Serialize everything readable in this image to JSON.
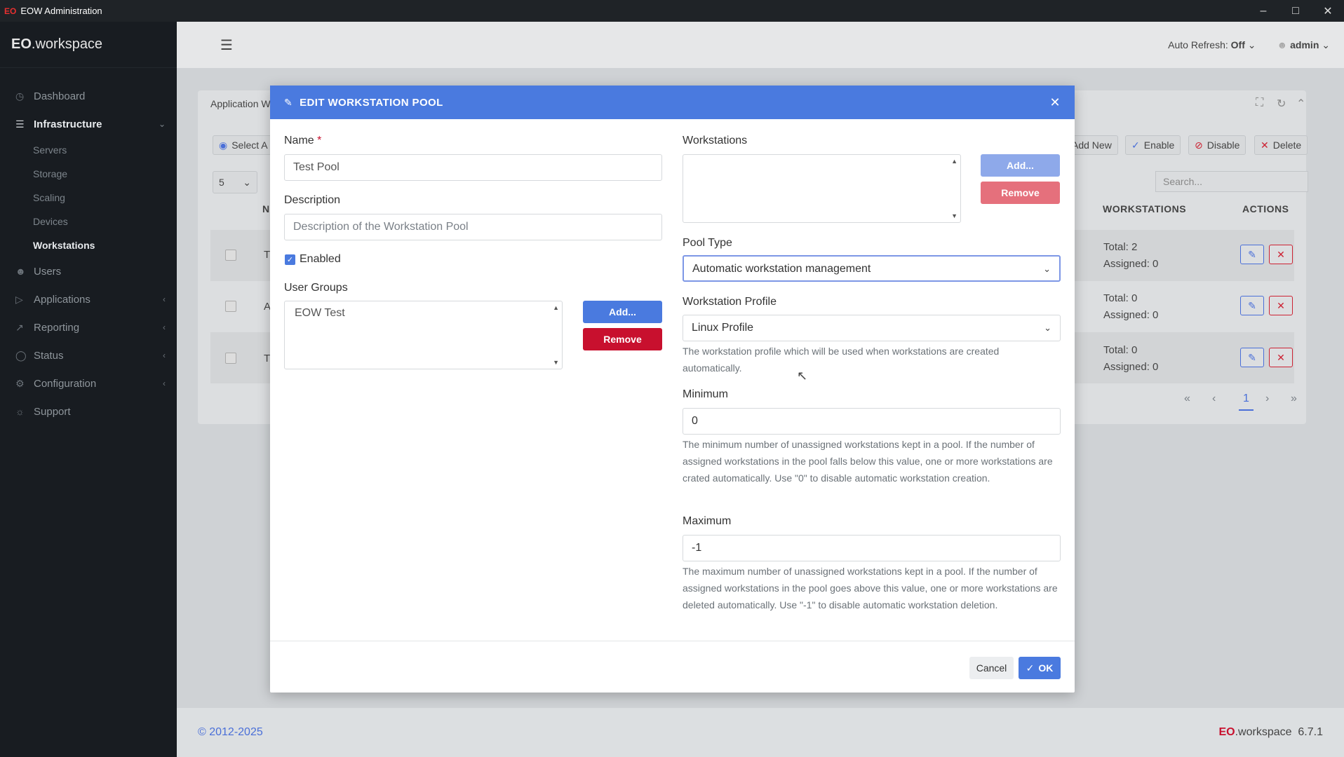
{
  "window": {
    "title": "EOW Administration",
    "logo": "EO"
  },
  "sidebar": {
    "brand_prefix": "EO",
    "brand_suffix": ".workspace",
    "items": [
      {
        "label": "Dashboard",
        "icon": "dashboard-icon"
      },
      {
        "label": "Infrastructure",
        "icon": "layers-icon"
      },
      {
        "label": "Users",
        "icon": "user-icon"
      },
      {
        "label": "Applications",
        "icon": "play-icon"
      },
      {
        "label": "Reporting",
        "icon": "chart-icon"
      },
      {
        "label": "Status",
        "icon": "status-icon"
      },
      {
        "label": "Configuration",
        "icon": "settings-icon"
      },
      {
        "label": "Support",
        "icon": "support-icon"
      }
    ],
    "subitems": [
      "Servers",
      "Storage",
      "Scaling",
      "Devices",
      "Workstations"
    ]
  },
  "topbar": {
    "auto_refresh_label": "Auto Refresh:",
    "auto_refresh_value": "Off",
    "user": "admin"
  },
  "background": {
    "card_title": "Application W",
    "select_all": "Select A",
    "page_size": "5",
    "toolbar": {
      "add_new": "Add New",
      "enable": "Enable",
      "disable": "Disable",
      "delete": "Delete"
    },
    "search_placeholder": "Search...",
    "columns": {
      "name": "N",
      "workstations": "WORKSTATIONS",
      "actions": "ACTIONS"
    },
    "rows": [
      {
        "name": "T",
        "total": "Total: 2",
        "assigned": "Assigned: 0"
      },
      {
        "name": "A",
        "total": "Total: 0",
        "assigned": "Assigned: 0"
      },
      {
        "name": "T",
        "total": "Total: 0",
        "assigned": "Assigned: 0"
      }
    ],
    "page": "1"
  },
  "footer": {
    "copyright": "© 2012-2025",
    "brand_prefix": "EO",
    "brand_suffix": ".workspace",
    "version": "6.7.1"
  },
  "modal": {
    "title": "EDIT WORKSTATION POOL",
    "name_label": "Name",
    "name_value": "Test Pool",
    "description_label": "Description",
    "description_placeholder": "Description of the Workstation Pool",
    "enabled_label": "Enabled",
    "user_groups_label": "User Groups",
    "user_groups": [
      "EOW Test"
    ],
    "add_label": "Add...",
    "remove_label": "Remove",
    "workstations_label": "Workstations",
    "pool_type_label": "Pool Type",
    "pool_type_value": "Automatic workstation management",
    "profile_label": "Workstation Profile",
    "profile_value": "Linux Profile",
    "profile_help": "The workstation profile which will be used when workstations are created automatically.",
    "minimum_label": "Minimum",
    "minimum_value": "0",
    "minimum_help": "The minimum number of unassigned workstations kept in a pool. If the number of assigned workstations in the pool falls below this value, one or more workstations are crated automatically. Use \"0\" to disable automatic workstation creation.",
    "maximum_label": "Maximum",
    "maximum_value": "-1",
    "maximum_help": "The maximum number of unassigned workstations kept in a pool. If the number of assigned workstations in the pool goes above this value, one or more workstations are deleted automatically. Use \"-1\" to disable automatic workstation deletion.",
    "cancel_label": "Cancel",
    "ok_label": "OK"
  }
}
